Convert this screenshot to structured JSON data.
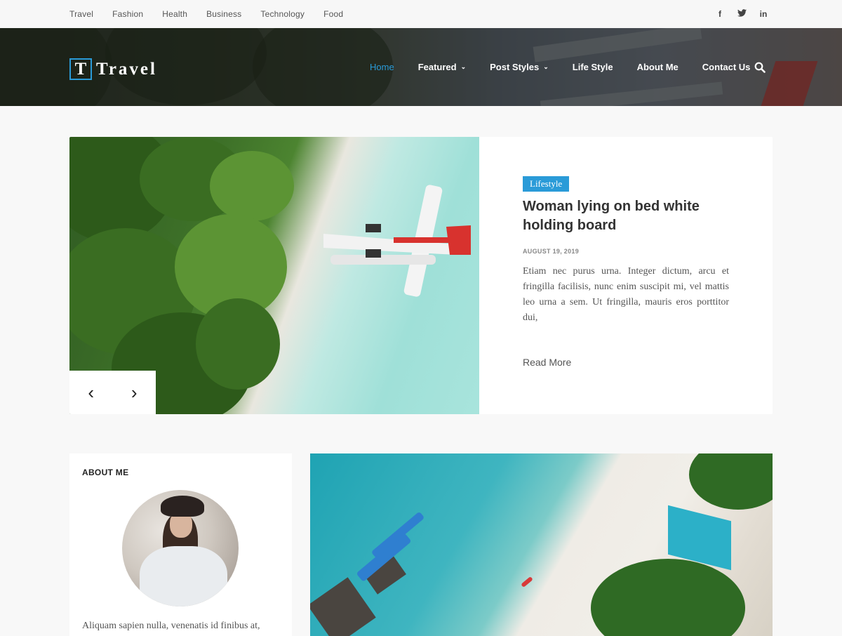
{
  "topbar": {
    "links": [
      "Travel",
      "Fashion",
      "Health",
      "Business",
      "Technology",
      "Food"
    ],
    "social": [
      {
        "icon": "facebook-icon",
        "glyph": "f"
      },
      {
        "icon": "twitter-icon",
        "glyph": "t"
      },
      {
        "icon": "linkedin-icon",
        "glyph": "in"
      }
    ]
  },
  "header": {
    "logo_letter": "T",
    "logo_text": "Travel",
    "nav": [
      {
        "label": "Home",
        "active": true,
        "dropdown": false
      },
      {
        "label": "Featured",
        "active": false,
        "dropdown": true
      },
      {
        "label": "Post Styles",
        "active": false,
        "dropdown": true
      },
      {
        "label": "Life Style",
        "active": false,
        "dropdown": false
      },
      {
        "label": "About Me",
        "active": false,
        "dropdown": false
      },
      {
        "label": "Contact Us",
        "active": false,
        "dropdown": false
      }
    ],
    "search_icon": "search-icon"
  },
  "hero": {
    "category": "Lifestyle",
    "title": "Woman lying on bed white holding board",
    "date": "AUGUST 19, 2019",
    "excerpt": "Etiam nec purus urna. Integer dictum, arcu et fringilla facilisis, nunc enim suscipit mi, vel mattis leo urna a sem. Ut fringilla, mauris eros porttitor dui,",
    "read_more": "Read More",
    "prev_glyph": "‹",
    "next_glyph": "›"
  },
  "about": {
    "heading": "ABOUT ME",
    "text": "Aliquam sapien nulla, venenatis id finibus at,"
  },
  "colors": {
    "accent": "#2a9bd8",
    "topbar_bg": "#f7f7f7",
    "page_bg": "#f8f8f8"
  }
}
